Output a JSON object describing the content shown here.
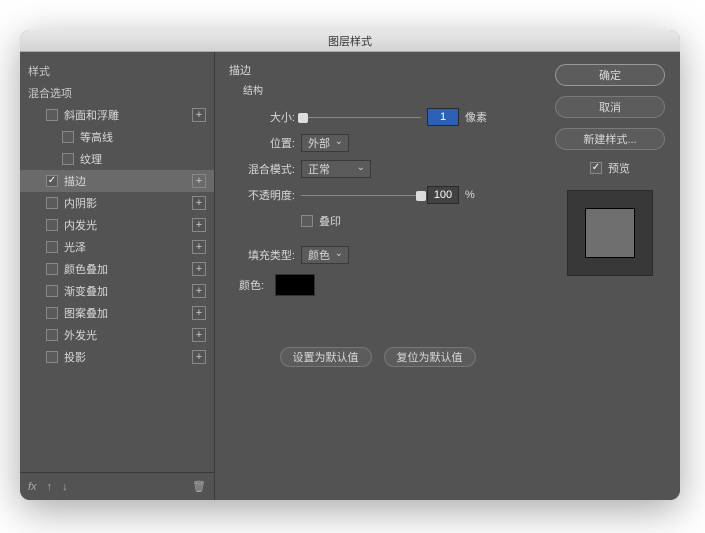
{
  "title": "图层样式",
  "sidebar": {
    "styles_header": "样式",
    "blend_header": "混合选项",
    "items": [
      {
        "label": "斜面和浮雕",
        "checked": false,
        "plus": true,
        "indent": 1
      },
      {
        "label": "等高线",
        "checked": false,
        "plus": false,
        "indent": 2
      },
      {
        "label": "纹理",
        "checked": false,
        "plus": false,
        "indent": 2
      },
      {
        "label": "描边",
        "checked": true,
        "plus": true,
        "indent": 1,
        "selected": true
      },
      {
        "label": "内阴影",
        "checked": false,
        "plus": true,
        "indent": 1
      },
      {
        "label": "内发光",
        "checked": false,
        "plus": true,
        "indent": 1
      },
      {
        "label": "光泽",
        "checked": false,
        "plus": true,
        "indent": 1
      },
      {
        "label": "颜色叠加",
        "checked": false,
        "plus": true,
        "indent": 1
      },
      {
        "label": "渐变叠加",
        "checked": false,
        "plus": true,
        "indent": 1
      },
      {
        "label": "图案叠加",
        "checked": false,
        "plus": true,
        "indent": 1
      },
      {
        "label": "外发光",
        "checked": false,
        "plus": true,
        "indent": 1
      },
      {
        "label": "投影",
        "checked": false,
        "plus": true,
        "indent": 1
      }
    ],
    "footer_fx": "fx"
  },
  "panel": {
    "title": "描边",
    "legend": "结构",
    "size_label": "大小:",
    "size_value": "1",
    "size_unit": "像素",
    "position_label": "位置:",
    "position_value": "外部",
    "blend_label": "混合模式:",
    "blend_value": "正常",
    "opacity_label": "不透明度:",
    "opacity_value": "100",
    "opacity_unit": "%",
    "overprint_label": "叠印",
    "fill_type_label": "填充类型:",
    "fill_type_value": "颜色",
    "color_label": "颜色:",
    "color_value": "#000000",
    "set_default": "设置为默认值",
    "reset_default": "复位为默认值"
  },
  "right": {
    "ok": "确定",
    "cancel": "取消",
    "new_style": "新建样式...",
    "preview_label": "预览",
    "preview_checked": true
  }
}
